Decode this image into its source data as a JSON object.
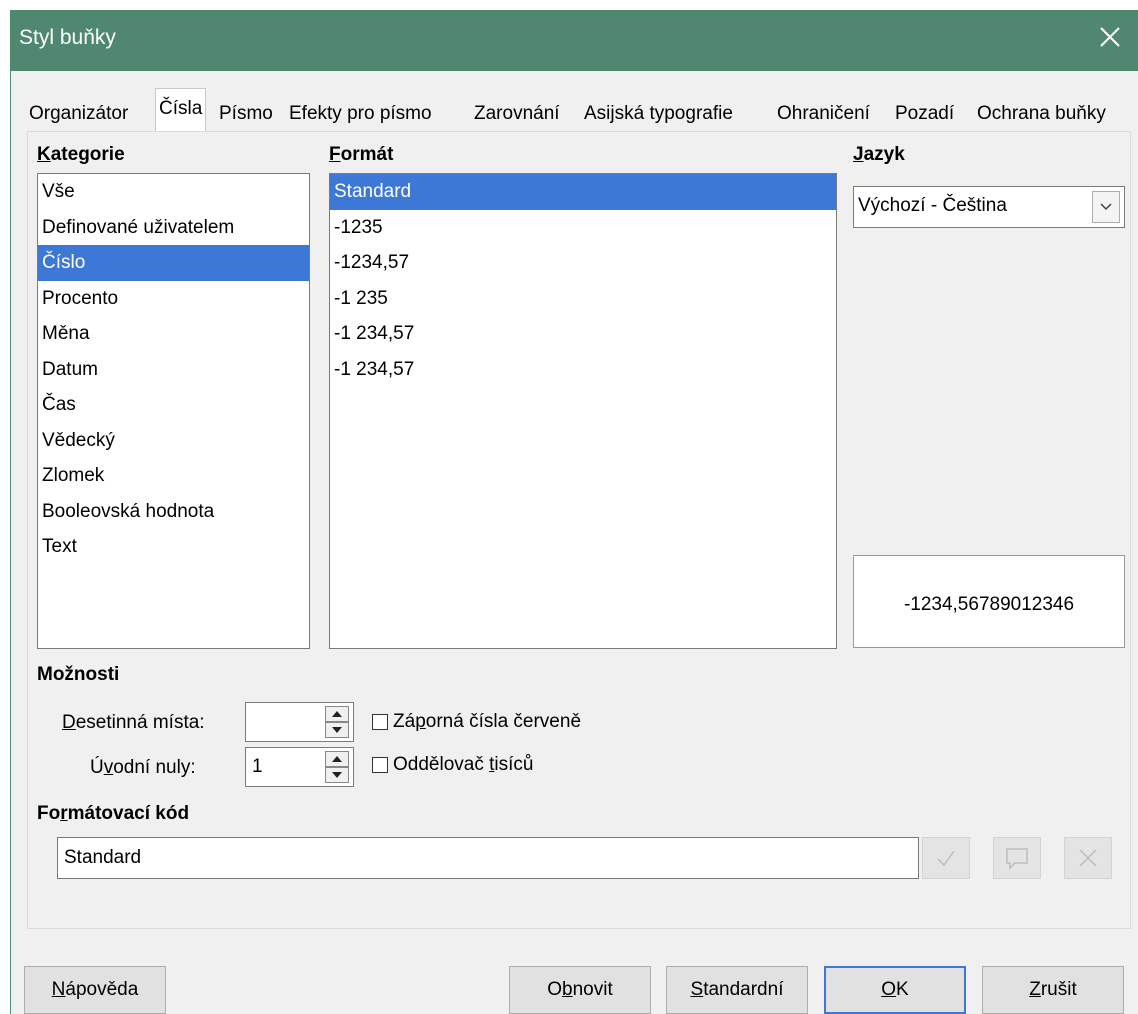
{
  "window": {
    "title": "Styl buňky"
  },
  "tabs": [
    {
      "label": "Organizátor"
    },
    {
      "label": "Čísla"
    },
    {
      "label": "Písmo"
    },
    {
      "label": "Efekty pro písmo"
    },
    {
      "label": "Zarovnání"
    },
    {
      "label": "Asijská typografie"
    },
    {
      "label": "Ohraničení"
    },
    {
      "label": "Pozadí"
    },
    {
      "label": "Ochrana buňky"
    }
  ],
  "active_tab": "Čísla",
  "category": {
    "heading_u": "K",
    "heading_rest": "ategorie",
    "items": [
      "Vše",
      "Definované uživatelem",
      "Číslo",
      "Procento",
      "Měna",
      "Datum",
      "Čas",
      "Vědecký",
      "Zlomek",
      "Booleovská hodnota",
      "Text"
    ],
    "selected": "Číslo"
  },
  "format": {
    "heading_u": "F",
    "heading_rest": "ormát",
    "items": [
      "Standard",
      "-1235",
      "-1234,57",
      "-1 235",
      "-1 234,57",
      "-1 234,57"
    ],
    "selected": "Standard"
  },
  "language": {
    "heading_u": "J",
    "heading_rest": "azyk",
    "value": "Výchozí - Čeština"
  },
  "preview": {
    "text": "-1234,56789012346"
  },
  "options": {
    "heading": "Možnosti",
    "decimal_label_u": "D",
    "decimal_label_rest": "esetinná místa:",
    "decimal_value": "",
    "leading_label_pre": "Ú",
    "leading_label_u": "v",
    "leading_label_rest": "odní nuly:",
    "leading_value": "1",
    "negative_red_pre": "Zá",
    "negative_red_u": "p",
    "negative_red_rest": "orná čísla červeně",
    "negative_red_checked": false,
    "thousands_pre": "Oddělovač ",
    "thousands_u": "t",
    "thousands_rest": "isíců",
    "thousands_checked": false
  },
  "format_code": {
    "heading_pre": "Fo",
    "heading_u": "r",
    "heading_rest": "mátovací kód",
    "value": "Standard"
  },
  "buttons": {
    "help_u": "N",
    "help_rest": "ápověda",
    "reset_pre": "O",
    "reset_u": "b",
    "reset_rest": "novit",
    "standard_u": "S",
    "standard_rest": "tandardní",
    "ok_u": "O",
    "ok_rest": "K",
    "cancel_u": "Z",
    "cancel_rest": "rušit"
  },
  "colors": {
    "titlebar": "#4f8771",
    "selection": "#3d78d6"
  }
}
